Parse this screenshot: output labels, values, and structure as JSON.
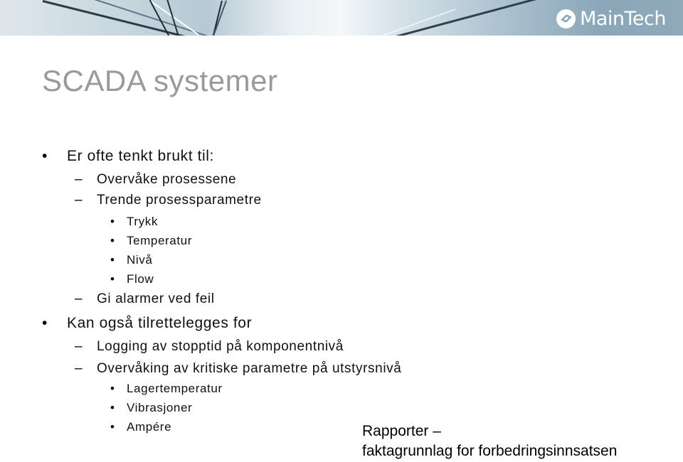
{
  "header": {
    "logo_text": "MainTech",
    "logo_icon": "maintech-logo-icon",
    "banner_colors": [
      "#dfe7ec",
      "#b6c9d4",
      "#f4f7f9",
      "#8aa6b8"
    ]
  },
  "slide": {
    "title": "SCADA systemer",
    "bullets": [
      {
        "text": "Er ofte tenkt brukt til:",
        "children": [
          {
            "text": "Overvåke prosessene"
          },
          {
            "text": "Trende prosessparametre",
            "children": [
              "Trykk",
              "Temperatur",
              "Nivå",
              "Flow"
            ]
          },
          {
            "text": "Gi alarmer ved feil"
          }
        ]
      },
      {
        "text": "Kan også tilrettelegges for",
        "children": [
          {
            "text": "Logging av stopptid på komponentnivå"
          },
          {
            "text": "Overvåking av kritiske parametre på utstyrsnivå",
            "children": [
              "Lagertemperatur",
              "Vibrasjoner",
              "Ampére"
            ]
          }
        ]
      }
    ],
    "note": {
      "line1": "Rapporter –",
      "line2": "faktagrunnlag for forbedringsinnsatsen"
    },
    "markers": {
      "level1": "•",
      "level2": "–",
      "level3": "•"
    },
    "colors": {
      "title": "#9a9a9a",
      "body": "#111111"
    }
  }
}
